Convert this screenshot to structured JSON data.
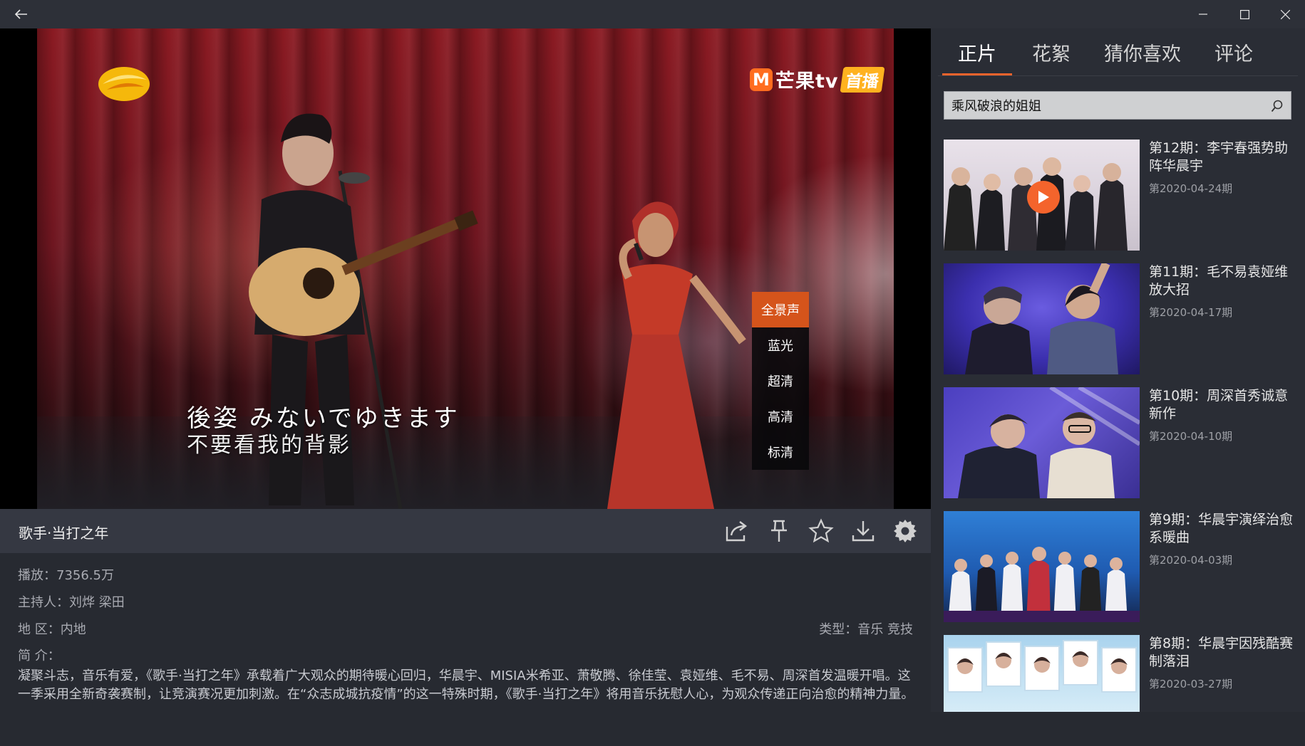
{
  "window": {
    "back_icon": "back-arrow-icon",
    "controls": [
      "minimize-icon",
      "maximize-icon",
      "close-icon"
    ]
  },
  "player": {
    "logo_left": "hunan-tv-logo",
    "logo_right_box": "M",
    "logo_right_text": "芒果tv",
    "logo_right_badge": "首播",
    "subtitle_line1": "後姿 みないでゆきます",
    "subtitle_line2": "不要看我的背影",
    "quality_options": [
      "全景声",
      "蓝光",
      "超清",
      "高清",
      "标清"
    ],
    "quality_selected": "全景声"
  },
  "info": {
    "title": "歌手·当打之年",
    "icons": [
      "share-icon",
      "pin-icon",
      "star-icon",
      "download-icon",
      "settings-icon"
    ]
  },
  "details": {
    "plays_label": "播放：",
    "plays_value": "7356.5万",
    "host_label": "主持人：",
    "host_value": "刘烨 梁田",
    "region_label": "地 区：",
    "region_value": "内地",
    "type_label": "类型：",
    "type_value": "音乐 竞技",
    "intro_label": "简 介：",
    "intro_text": "凝聚斗志，音乐有爱，《歌手·当打之年》承载着广大观众的期待暖心回归，华晨宇、MISIA米希亚、萧敬腾、徐佳莹、袁娅维、毛不易、周深首发温暖开唱。这一季采用全新奇袭赛制，让竞演赛况更加刺激。在“众志成城抗疫情”的这一特殊时期，《歌手·当打之年》将用音乐抚慰人心，为观众传递正向治愈的精神力量。"
  },
  "panel": {
    "tabs": [
      "正片",
      "花絮",
      "猜你喜欢",
      "评论"
    ],
    "active_tab": "正片",
    "search_value": "乘风破浪的姐姐",
    "search_icon": "search-icon",
    "episodes": [
      {
        "title": "第12期：李宇春强势助阵华晨宇",
        "date": "第2020-04-24期",
        "playing": true
      },
      {
        "title": "第11期：毛不易袁娅维放大招",
        "date": "第2020-04-17期",
        "playing": false
      },
      {
        "title": "第10期：周深首秀诚意新作",
        "date": "第2020-04-10期",
        "playing": false
      },
      {
        "title": "第9期：华晨宇演绎治愈系暖曲",
        "date": "第2020-04-03期",
        "playing": false
      },
      {
        "title": "第8期：华晨宇因残酷赛制落泪",
        "date": "第2020-03-27期",
        "playing": false
      }
    ]
  },
  "colors": {
    "accent": "#f4642c",
    "quality_active": "#d5541b",
    "background": "#272a31",
    "panel": "#2a2d35"
  }
}
